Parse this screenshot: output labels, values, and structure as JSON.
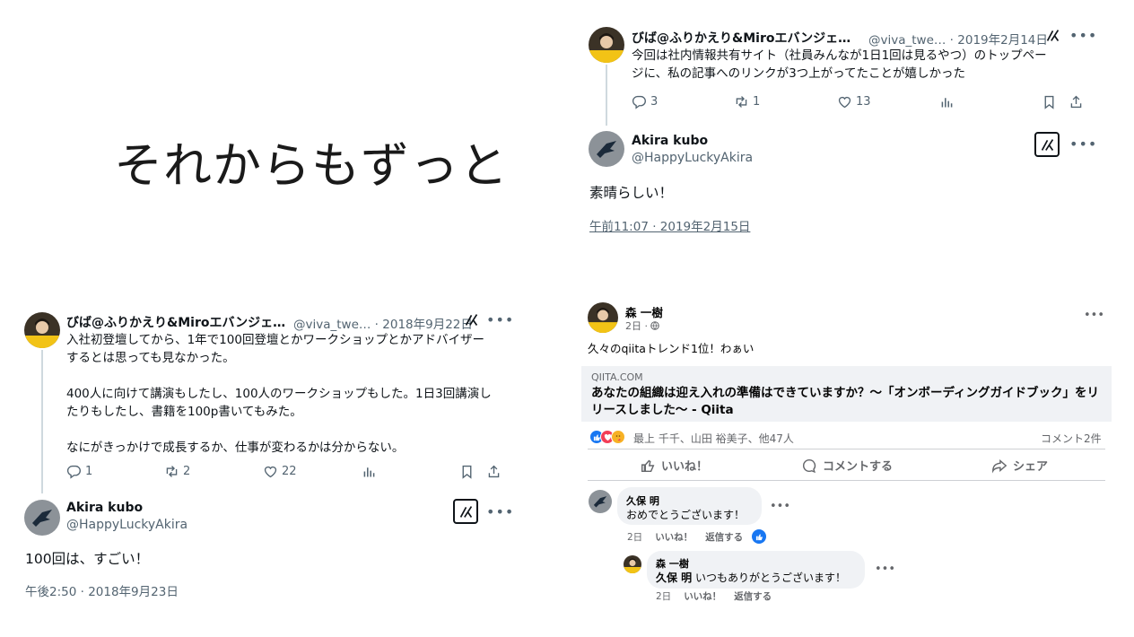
{
  "slide": {
    "title": "それからもずっと"
  },
  "tweet1": {
    "author": "びば@ふりかえり&Miroエバンジェ…",
    "handle_date": "@viva_twe… · 2019年2月14日",
    "body": [
      "今回は社内情報共有サイト（社員みんなが1日1回は見るやつ）のトップペー",
      "ジに、私の記事へのリンクが3つ上がってたことが嬉しかった"
    ],
    "replies": "3",
    "retweets": "1",
    "likes": "13"
  },
  "reply1": {
    "author": "Akira kubo",
    "handle": "@HappyLuckyAkira",
    "text": "素晴らしい！",
    "timestamp": "午前11:07 · 2019年2月15日"
  },
  "tweet2": {
    "author": "びば@ふりかえり&Miroエバンジェ…",
    "handle_date": "@viva_twe… · 2018年9月22日",
    "body": [
      "入社初登壇してから、1年で100回登壇とかワークショップとかアドバイザー",
      "するとは思っても見なかった。",
      "",
      "400人に向けて講演もしたし、100人のワークショップもした。1日3回講演し",
      "たりもしたし、書籍を100p書いてもみた。",
      "",
      "なにがきっかけで成長するか、仕事が変わるかは分からない。"
    ],
    "replies": "1",
    "retweets": "2",
    "likes": "22"
  },
  "reply2": {
    "author": "Akira kubo",
    "handle": "@HappyLuckyAkira",
    "text": "100回は、すごい！",
    "timestamp": "午後2:50 · 2018年9月23日"
  },
  "fb_post": {
    "author": "森 一樹",
    "time": "2日 ·",
    "text": "久々のqiitaトレンド1位！わぁい",
    "card_domain": "QIITA.COM",
    "card_title": "あなたの組織は迎え入れの準備はできていますか？～「オンボーディングガイドブック」をリリースしました～ - Qiita",
    "reactions_text": "最上 千千、山田 裕美子、他47人",
    "comment_count": "コメント2件",
    "action_like": "いいね！",
    "action_comment": "コメントする",
    "action_share": "シェア"
  },
  "fb_comment1": {
    "author": "久保 明",
    "text": "おめでとうございます！",
    "time": "2日",
    "like": "いいね！",
    "reply": "返信する"
  },
  "fb_comment2": {
    "author": "森 一樹",
    "mention": "久保 明",
    "text": " いつもありがとうございます！",
    "time": "2日",
    "like": "いいね！",
    "reply": "返信する"
  },
  "colors": {
    "twitter_text": "#0f1419",
    "twitter_meta": "#536471",
    "fb_bg_gray": "#f0f2f5",
    "fb_like_blue": "#1877f2",
    "fb_love_red": "#f33e58",
    "avatar_yellow": "#f2c316"
  },
  "icons": [
    "reply-icon",
    "retweet-icon",
    "like-icon",
    "views-icon",
    "bookmark-icon",
    "share-icon",
    "grok-icon",
    "more-icon",
    "globe-icon",
    "thumbs-up-icon",
    "comment-icon",
    "share-arrow-icon"
  ]
}
